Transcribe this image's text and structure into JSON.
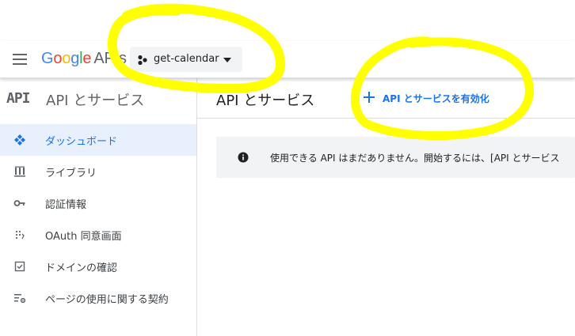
{
  "header": {
    "logo_google": "Google",
    "logo_apis": "APIs",
    "project_name": "get-calendar"
  },
  "sidebar": {
    "logo_text": "API",
    "title": "API とサービス",
    "items": [
      {
        "label": "ダッシュボード",
        "icon": "dashboard-icon",
        "active": true
      },
      {
        "label": "ライブラリ",
        "icon": "library-icon",
        "active": false
      },
      {
        "label": "認証情報",
        "icon": "key-icon",
        "active": false
      },
      {
        "label": "OAuth 同意画面",
        "icon": "oauth-consent-icon",
        "active": false
      },
      {
        "label": "ドメインの確認",
        "icon": "checkbox-icon",
        "active": false
      },
      {
        "label": "ページの使用に関する契約",
        "icon": "settings-list-icon",
        "active": false
      }
    ]
  },
  "main": {
    "title": "API とサービス",
    "enable_button": "API とサービスを有効化",
    "info_text": "使用できる API はまだありません。開始するには、[API とサービス"
  },
  "colors": {
    "accent": "#1a73e8",
    "active_bg": "#e8f0fe",
    "highlight_marker": "#ffff00"
  }
}
